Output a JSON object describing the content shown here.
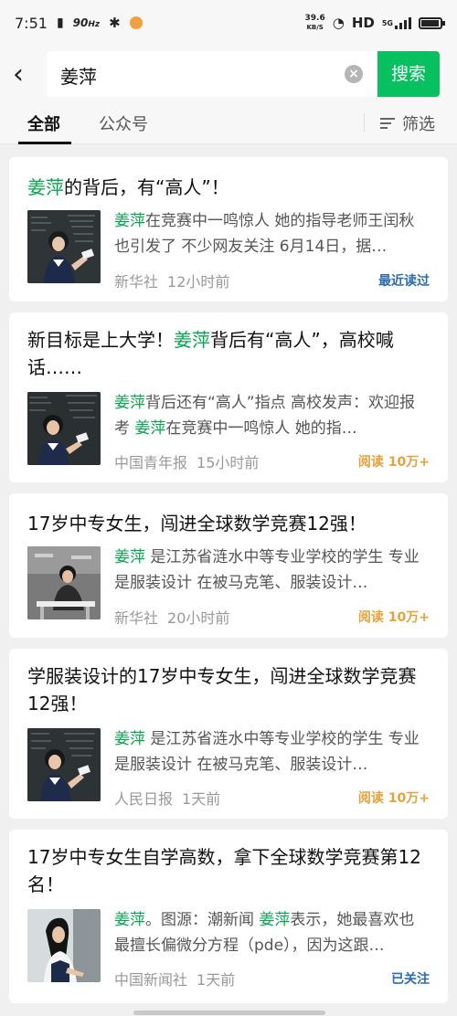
{
  "status_bar": {
    "time": "7:51",
    "refresh": "90",
    "refresh_unit": "Hz",
    "speed_value": "39.6",
    "speed_unit": "KB/S",
    "hd": "HD",
    "network": "5G"
  },
  "search": {
    "query": "姜萍",
    "button": "搜索"
  },
  "tabs": [
    {
      "label": "全部"
    },
    {
      "label": "公众号"
    }
  ],
  "filter_label": "筛选",
  "highlight_color": "#07a651",
  "results": [
    {
      "title_parts": [
        "姜萍",
        "的背后，有“高人”！"
      ],
      "snippet_parts": [
        "姜萍",
        "在竞赛中一鸣惊人 她的指导老师王闰秋也引发了 不少网友关注 6月14日，据…"
      ],
      "source": "新华社",
      "time": "12小时前",
      "tag": "最近读过",
      "tag_color": "#2b6cb0"
    },
    {
      "title_parts": [
        "新目标是上大学！",
        "姜萍",
        "背后有“高人”，高校喊话……"
      ],
      "snippet_parts": [
        "姜萍",
        "背后还有“高人”指点 高校发声：欢迎报考 ",
        "姜萍",
        "在竞赛中一鸣惊人 她的指…"
      ],
      "source": "中国青年报",
      "time": "15小时前",
      "tag": "阅读 10万+",
      "tag_color": "#e6a23c"
    },
    {
      "title_parts": [
        "17岁中专女生，闯进全球数学竞赛12强！"
      ],
      "snippet_parts": [
        "姜萍",
        " 是江苏省涟水中等专业学校的学生 专业是服装设计 在被马克笔、服装设计…"
      ],
      "source": "新华社",
      "time": "20小时前",
      "tag": "阅读 10万+",
      "tag_color": "#e6a23c"
    },
    {
      "title_parts": [
        "学服装设计的17岁中专女生，闯进全球数学竞赛12强！"
      ],
      "snippet_parts": [
        "姜萍",
        " 是江苏省涟水中等专业学校的学生 专业是服装设计 在被马克笔、服装设计…"
      ],
      "source": "人民日报",
      "time": "1天前",
      "tag": "阅读 10万+",
      "tag_color": "#e6a23c"
    },
    {
      "title_parts": [
        "17岁中专女生自学高数，拿下全球数学竞赛第12名！"
      ],
      "snippet_parts": [
        "姜萍",
        "。图源：潮新闻 ",
        "姜萍",
        "表示，她最喜欢也最擅长偏微分方程（pde），因为这跟…"
      ],
      "source": "中国新闻社",
      "time": "1天前",
      "tag": "已关注",
      "tag_color": "#2b6cb0"
    }
  ]
}
